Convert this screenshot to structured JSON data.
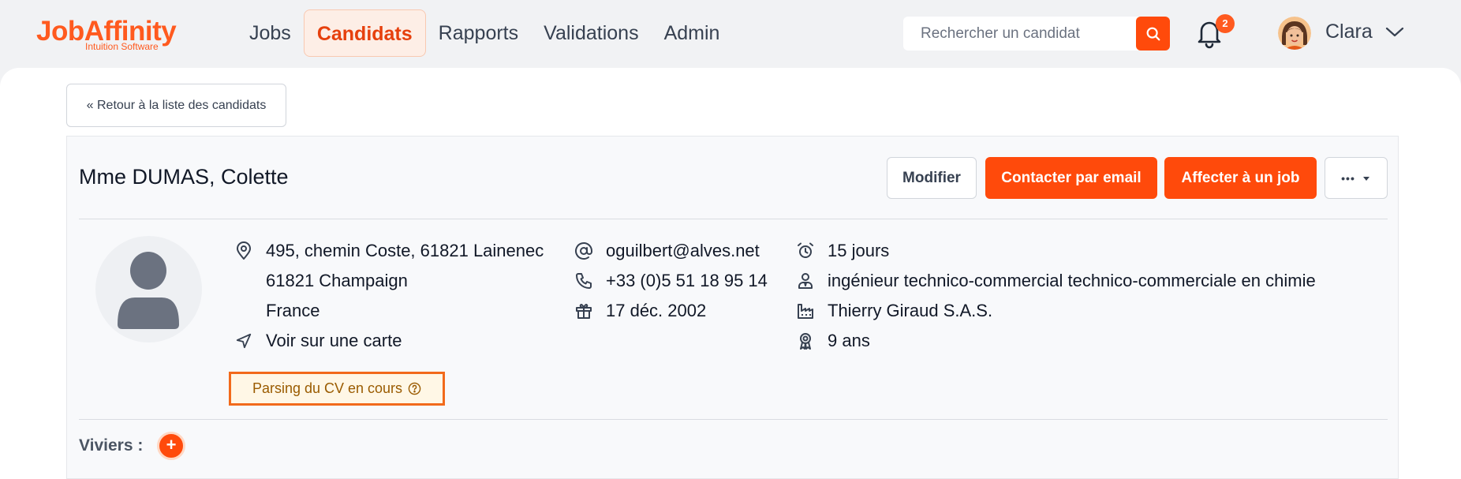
{
  "brand": {
    "name": "JobAffinity",
    "tagline": "Intuition Software"
  },
  "nav": {
    "items": [
      {
        "label": "Jobs",
        "active": false
      },
      {
        "label": "Candidats",
        "active": true
      },
      {
        "label": "Rapports",
        "active": false
      },
      {
        "label": "Validations",
        "active": false
      },
      {
        "label": "Admin",
        "active": false
      }
    ]
  },
  "search": {
    "placeholder": "Rechercher un candidat",
    "value": ""
  },
  "notifications": {
    "count": "2"
  },
  "user": {
    "name": "Clara"
  },
  "back_label": "« Retour à la liste des candidats",
  "candidate": {
    "name": "Mme DUMAS, Colette",
    "actions": {
      "edit": "Modifier",
      "contact": "Contacter par email",
      "assign": "Affecter à un job",
      "more": "•••"
    },
    "address": {
      "line1": "495, chemin Coste, 61821 Lainenec",
      "line2": "61821 Champaign",
      "country": "France",
      "map_link": "Voir sur une carte"
    },
    "email": "oguilbert@alves.net",
    "phone": "+33 (0)5 51 18 95 14",
    "birthdate": "17 déc. 2002",
    "availability": "15 jours",
    "position": "ingénieur technico-commercial technico-commerciale en chimie",
    "company": "Thierry Giraud S.A.S.",
    "experience": " 9 ans",
    "parsing_status": "Parsing du CV en cours"
  },
  "viviers": {
    "label": "Viviers :",
    "add": "+"
  },
  "colors": {
    "accent": "#ff4a0b",
    "brand": "#ff5a1f",
    "warning_bg": "#fff7e6",
    "warning_text": "#9a5b00"
  },
  "icons": [
    "search-icon",
    "bell-icon",
    "chevron-down-icon",
    "location-pin-icon",
    "navigation-arrow-icon",
    "at-sign-icon",
    "phone-icon",
    "gift-icon",
    "alarm-clock-icon",
    "user-tie-icon",
    "factory-icon",
    "award-icon",
    "help-circle-icon",
    "plus-icon",
    "caret-down-icon"
  ]
}
